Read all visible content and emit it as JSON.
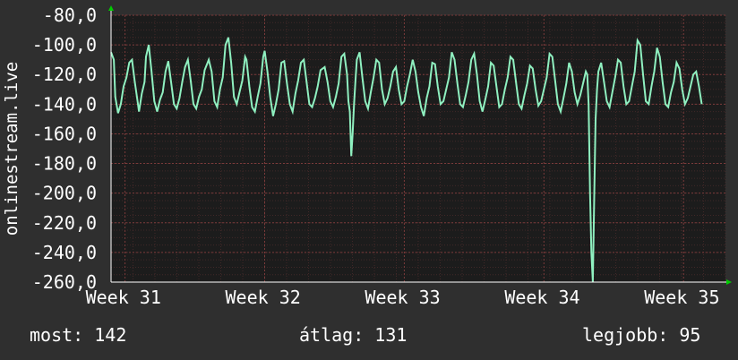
{
  "chart_data": {
    "type": "line",
    "ylabel": "onlinestream.live",
    "ylim": [
      -260,
      -80
    ],
    "yticks": [
      {
        "value": -80,
        "label": "-80,0"
      },
      {
        "value": -100,
        "label": "-100,0"
      },
      {
        "value": -120,
        "label": "-120,0"
      },
      {
        "value": -140,
        "label": "-140,0"
      },
      {
        "value": -160,
        "label": "-160,0"
      },
      {
        "value": -180,
        "label": "-180,0"
      },
      {
        "value": -200,
        "label": "-200,0"
      },
      {
        "value": -220,
        "label": "-220,0"
      },
      {
        "value": -240,
        "label": "-240,0"
      },
      {
        "value": -260,
        "label": "-260,0"
      }
    ],
    "xlim": [
      30.9,
      35.3
    ],
    "xticks": [
      {
        "value": 31,
        "label": "Week 31"
      },
      {
        "value": 32,
        "label": "Week 32"
      },
      {
        "value": 33,
        "label": "Week 33"
      },
      {
        "value": 34,
        "label": "Week 34"
      },
      {
        "value": 35,
        "label": "Week 35"
      }
    ],
    "grid": true,
    "colors": {
      "background": "#2f2f2f",
      "plot_background": "#1c1c1c",
      "grid": "#5a3030",
      "line": "#8ff0c0",
      "arrow": "#00cc00"
    },
    "series": [
      {
        "values": [
          [
            30.9,
            -105
          ],
          [
            30.92,
            -110
          ],
          [
            30.93,
            -135
          ],
          [
            30.95,
            -146
          ],
          [
            30.97,
            -140
          ],
          [
            30.99,
            -128
          ],
          [
            31.01,
            -122
          ],
          [
            31.03,
            -112
          ],
          [
            31.05,
            -110
          ],
          [
            31.07,
            -125
          ],
          [
            31.09,
            -138
          ],
          [
            31.1,
            -145
          ],
          [
            31.12,
            -133
          ],
          [
            31.14,
            -125
          ],
          [
            31.15,
            -108
          ],
          [
            31.17,
            -100
          ],
          [
            31.19,
            -118
          ],
          [
            31.21,
            -138
          ],
          [
            31.23,
            -145
          ],
          [
            31.25,
            -137
          ],
          [
            31.27,
            -132
          ],
          [
            31.29,
            -118
          ],
          [
            31.31,
            -111
          ],
          [
            31.33,
            -125
          ],
          [
            31.35,
            -140
          ],
          [
            31.37,
            -143
          ],
          [
            31.39,
            -136
          ],
          [
            31.41,
            -125
          ],
          [
            31.43,
            -115
          ],
          [
            31.45,
            -110
          ],
          [
            31.47,
            -124
          ],
          [
            31.49,
            -140
          ],
          [
            31.51,
            -143
          ],
          [
            31.53,
            -135
          ],
          [
            31.55,
            -130
          ],
          [
            31.57,
            -117
          ],
          [
            31.6,
            -110
          ],
          [
            31.62,
            -118
          ],
          [
            31.64,
            -138
          ],
          [
            31.66,
            -142
          ],
          [
            31.68,
            -130
          ],
          [
            31.7,
            -122
          ],
          [
            31.72,
            -100
          ],
          [
            31.74,
            -95
          ],
          [
            31.76,
            -112
          ],
          [
            31.78,
            -135
          ],
          [
            31.8,
            -140
          ],
          [
            31.82,
            -132
          ],
          [
            31.84,
            -124
          ],
          [
            31.86,
            -108
          ],
          [
            31.87,
            -110
          ],
          [
            31.89,
            -128
          ],
          [
            31.91,
            -142
          ],
          [
            31.93,
            -145
          ],
          [
            31.95,
            -135
          ],
          [
            31.97,
            -126
          ],
          [
            31.99,
            -108
          ],
          [
            32.0,
            -104
          ],
          [
            32.02,
            -118
          ],
          [
            32.04,
            -135
          ],
          [
            32.06,
            -148
          ],
          [
            32.08,
            -140
          ],
          [
            32.1,
            -130
          ],
          [
            32.12,
            -112
          ],
          [
            32.14,
            -111
          ],
          [
            32.16,
            -126
          ],
          [
            32.18,
            -140
          ],
          [
            32.2,
            -145
          ],
          [
            32.22,
            -133
          ],
          [
            32.24,
            -124
          ],
          [
            32.26,
            -112
          ],
          [
            32.28,
            -110
          ],
          [
            32.3,
            -125
          ],
          [
            32.32,
            -140
          ],
          [
            32.34,
            -142
          ],
          [
            32.36,
            -136
          ],
          [
            32.38,
            -128
          ],
          [
            32.4,
            -117
          ],
          [
            32.43,
            -115
          ],
          [
            32.45,
            -125
          ],
          [
            32.47,
            -138
          ],
          [
            32.49,
            -142
          ],
          [
            32.51,
            -135
          ],
          [
            32.53,
            -126
          ],
          [
            32.55,
            -108
          ],
          [
            32.57,
            -106
          ],
          [
            32.59,
            -120
          ],
          [
            32.6,
            -138
          ],
          [
            32.61,
            -145
          ],
          [
            32.62,
            -175
          ],
          [
            32.63,
            -160
          ],
          [
            32.64,
            -140
          ],
          [
            32.65,
            -125
          ],
          [
            32.66,
            -110
          ],
          [
            32.68,
            -105
          ],
          [
            32.7,
            -122
          ],
          [
            32.72,
            -138
          ],
          [
            32.74,
            -143
          ],
          [
            32.76,
            -132
          ],
          [
            32.78,
            -122
          ],
          [
            32.8,
            -110
          ],
          [
            32.82,
            -112
          ],
          [
            32.84,
            -130
          ],
          [
            32.86,
            -140
          ],
          [
            32.88,
            -136
          ],
          [
            32.9,
            -128
          ],
          [
            32.92,
            -118
          ],
          [
            32.94,
            -115
          ],
          [
            32.96,
            -130
          ],
          [
            32.98,
            -140
          ],
          [
            33.0,
            -138
          ],
          [
            33.02,
            -128
          ],
          [
            33.04,
            -120
          ],
          [
            33.06,
            -110
          ],
          [
            33.08,
            -118
          ],
          [
            33.1,
            -132
          ],
          [
            33.12,
            -142
          ],
          [
            33.14,
            -148
          ],
          [
            33.16,
            -136
          ],
          [
            33.18,
            -128
          ],
          [
            33.2,
            -112
          ],
          [
            33.22,
            -113
          ],
          [
            33.24,
            -128
          ],
          [
            33.26,
            -140
          ],
          [
            33.28,
            -138
          ],
          [
            33.3,
            -130
          ],
          [
            33.32,
            -122
          ],
          [
            33.34,
            -105
          ],
          [
            33.36,
            -110
          ],
          [
            33.38,
            -126
          ],
          [
            33.4,
            -140
          ],
          [
            33.42,
            -142
          ],
          [
            33.44,
            -134
          ],
          [
            33.46,
            -125
          ],
          [
            33.48,
            -110
          ],
          [
            33.5,
            -106
          ],
          [
            33.52,
            -120
          ],
          [
            33.54,
            -138
          ],
          [
            33.56,
            -145
          ],
          [
            33.58,
            -137
          ],
          [
            33.6,
            -128
          ],
          [
            33.62,
            -112
          ],
          [
            33.64,
            -114
          ],
          [
            33.66,
            -128
          ],
          [
            33.68,
            -142
          ],
          [
            33.7,
            -140
          ],
          [
            33.72,
            -130
          ],
          [
            33.74,
            -122
          ],
          [
            33.76,
            -108
          ],
          [
            33.78,
            -110
          ],
          [
            33.8,
            -125
          ],
          [
            33.82,
            -140
          ],
          [
            33.84,
            -143
          ],
          [
            33.86,
            -134
          ],
          [
            33.88,
            -126
          ],
          [
            33.9,
            -114
          ],
          [
            33.92,
            -116
          ],
          [
            33.94,
            -130
          ],
          [
            33.96,
            -141
          ],
          [
            33.98,
            -138
          ],
          [
            34.0,
            -130
          ],
          [
            34.02,
            -122
          ],
          [
            34.04,
            -106
          ],
          [
            34.06,
            -108
          ],
          [
            34.08,
            -124
          ],
          [
            34.1,
            -140
          ],
          [
            34.12,
            -145
          ],
          [
            34.14,
            -136
          ],
          [
            34.16,
            -126
          ],
          [
            34.18,
            -112
          ],
          [
            34.2,
            -118
          ],
          [
            34.22,
            -132
          ],
          [
            34.24,
            -140
          ],
          [
            34.26,
            -134
          ],
          [
            34.28,
            -126
          ],
          [
            34.3,
            -118
          ],
          [
            34.31,
            -120
          ],
          [
            34.32,
            -140
          ],
          [
            34.33,
            -200
          ],
          [
            34.34,
            -240
          ],
          [
            34.35,
            -260
          ],
          [
            34.36,
            -205
          ],
          [
            34.37,
            -150
          ],
          [
            34.38,
            -130
          ],
          [
            34.39,
            -118
          ],
          [
            34.41,
            -112
          ],
          [
            34.43,
            -125
          ],
          [
            34.45,
            -138
          ],
          [
            34.47,
            -142
          ],
          [
            34.49,
            -132
          ],
          [
            34.51,
            -122
          ],
          [
            34.53,
            -110
          ],
          [
            34.55,
            -112
          ],
          [
            34.57,
            -128
          ],
          [
            34.59,
            -140
          ],
          [
            34.61,
            -138
          ],
          [
            34.63,
            -128
          ],
          [
            34.65,
            -118
          ],
          [
            34.67,
            -97
          ],
          [
            34.69,
            -100
          ],
          [
            34.71,
            -120
          ],
          [
            34.73,
            -138
          ],
          [
            34.75,
            -140
          ],
          [
            34.77,
            -128
          ],
          [
            34.79,
            -118
          ],
          [
            34.81,
            -102
          ],
          [
            34.83,
            -108
          ],
          [
            34.85,
            -125
          ],
          [
            34.87,
            -140
          ],
          [
            34.89,
            -142
          ],
          [
            34.91,
            -132
          ],
          [
            34.93,
            -125
          ],
          [
            34.95,
            -112
          ],
          [
            34.97,
            -116
          ],
          [
            34.99,
            -130
          ],
          [
            35.01,
            -140
          ],
          [
            35.03,
            -136
          ],
          [
            35.05,
            -128
          ],
          [
            35.07,
            -120
          ],
          [
            35.09,
            -118
          ],
          [
            35.11,
            -128
          ],
          [
            35.13,
            -140
          ]
        ]
      }
    ]
  },
  "stats": [
    {
      "label": "most:",
      "value": "142"
    },
    {
      "label": "átlag:",
      "value": "131"
    },
    {
      "label": "legjobb:",
      "value": "95"
    }
  ]
}
